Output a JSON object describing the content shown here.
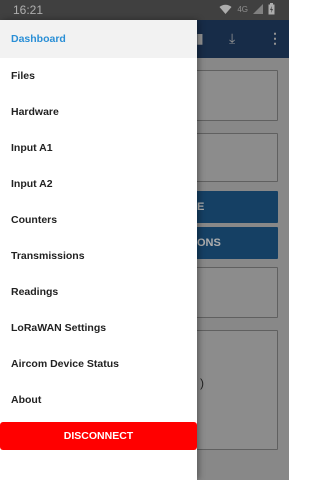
{
  "status_bar": {
    "time": "16:21",
    "network": "4G",
    "icons": [
      "wifi-icon",
      "signal-icon",
      "battery-icon"
    ]
  },
  "drawer": {
    "items": [
      {
        "label": "Dashboard",
        "active": true
      },
      {
        "label": "Files",
        "active": false
      },
      {
        "label": "Hardware",
        "active": false
      },
      {
        "label": "Input A1",
        "active": false
      },
      {
        "label": "Input A2",
        "active": false
      },
      {
        "label": "Counters",
        "active": false
      },
      {
        "label": "Transmissions",
        "active": false
      },
      {
        "label": "Readings",
        "active": false
      },
      {
        "label": "LoRaWAN Settings",
        "active": false
      },
      {
        "label": "Aircom Device Status",
        "active": false
      },
      {
        "label": "About",
        "active": false
      }
    ],
    "disconnect_label": "DISCONNECT"
  },
  "background": {
    "toolbar_icons": [
      "save-icon",
      "download-icon",
      "more-vert-icon"
    ],
    "fragments": [
      "E",
      "ONS",
      ")"
    ]
  },
  "colors": {
    "active_item": "#2a8fd6",
    "disconnect": "#ff0000",
    "toolbar": "#23426b",
    "status_bar": "#5f5f5f"
  }
}
